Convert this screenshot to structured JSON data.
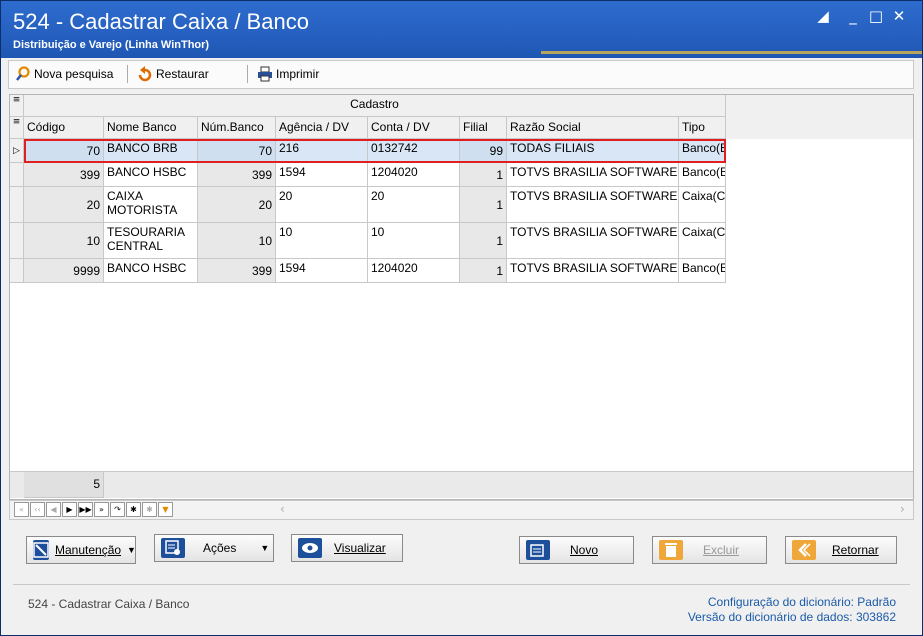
{
  "window": {
    "title": "524 - Cadastrar Caixa / Banco",
    "subtitle": "Distribuição e Varejo (Linha WinThor)"
  },
  "toolbar": {
    "nova_pesquisa": "Nova pesquisa",
    "restaurar": "Restaurar",
    "imprimir": "Imprimir"
  },
  "grid": {
    "band_title": "Cadastro",
    "columns": [
      "Código",
      "Nome Banco",
      "Núm.Banco",
      "Agência / DV",
      "Conta / DV",
      "Filial",
      "Razão Social",
      "Tipo"
    ],
    "rows": [
      [
        "70",
        "BANCO BRB",
        "70",
        "216",
        "0132742",
        "99",
        "TODAS FILIAIS",
        "Banco(E"
      ],
      [
        "399",
        "BANCO HSBC",
        "399",
        "1594",
        "1204020",
        "1",
        "TOTVS BRASILIA SOFTWARE -",
        "Banco(E"
      ],
      [
        "20",
        "CAIXA MOTORISTA",
        "20",
        "20",
        "20",
        "1",
        "TOTVS BRASILIA SOFTWARE -",
        "Caixa(C"
      ],
      [
        "10",
        "TESOURARIA CENTRAL",
        "10",
        "10",
        "10",
        "1",
        "TOTVS BRASILIA SOFTWARE -",
        "Caixa(C"
      ],
      [
        "9999",
        "BANCO HSBC",
        "399",
        "1594",
        "1204020",
        "1",
        "TOTVS BRASILIA SOFTWARE -",
        "Banco(E"
      ]
    ],
    "row_count": "5",
    "highlight_color": "#e02020"
  },
  "buttons": {
    "manutencao": "Manutenção",
    "acoes": "Ações",
    "visualizar": "Visualizar",
    "novo": "Novo",
    "excluir": "Excluir",
    "retornar": "Retornar"
  },
  "status": {
    "left": "524 - Cadastrar Caixa / Banco",
    "config_label": "Configuração do dicionário:",
    "config_value": "Padrão",
    "version_label": "Versão do dicionário de dados:",
    "version_value": "303862"
  }
}
